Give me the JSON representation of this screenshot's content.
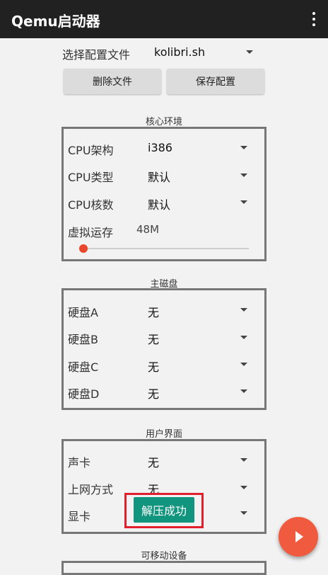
{
  "app": {
    "title": "Qemu启动器"
  },
  "config": {
    "label": "选择配置文件",
    "value": "kolibri.sh"
  },
  "buttons": {
    "delete": "删除文件",
    "save": "保存配置"
  },
  "core": {
    "title": "核心环境",
    "rows": [
      {
        "label": "CPU架构",
        "value": "i386"
      },
      {
        "label": "CPU类型",
        "value": "默认"
      },
      {
        "label": "CPU核数",
        "value": "默认"
      }
    ],
    "memory": {
      "label": "虚拟运存",
      "value": "48M",
      "level": 0.01
    }
  },
  "disks": {
    "title": "主磁盘",
    "rows": [
      {
        "label": "硬盘A",
        "value": "无"
      },
      {
        "label": "硬盘B",
        "value": "无"
      },
      {
        "label": "硬盘C",
        "value": "无"
      },
      {
        "label": "硬盘D",
        "value": "无"
      }
    ]
  },
  "ui": {
    "title": "用户界面",
    "rows": [
      {
        "label": "声卡",
        "value": "无"
      },
      {
        "label": "上网方式",
        "value": "无"
      },
      {
        "label": "显卡",
        "value": ""
      }
    ]
  },
  "removable": {
    "title": "可移动设备"
  },
  "toast": {
    "text": "解压成功"
  },
  "colors": {
    "appbar": "#212121",
    "toast": "#12957e",
    "fab": "#f05a3e",
    "highlight": "#e0202c",
    "slider": "#e8472b"
  }
}
